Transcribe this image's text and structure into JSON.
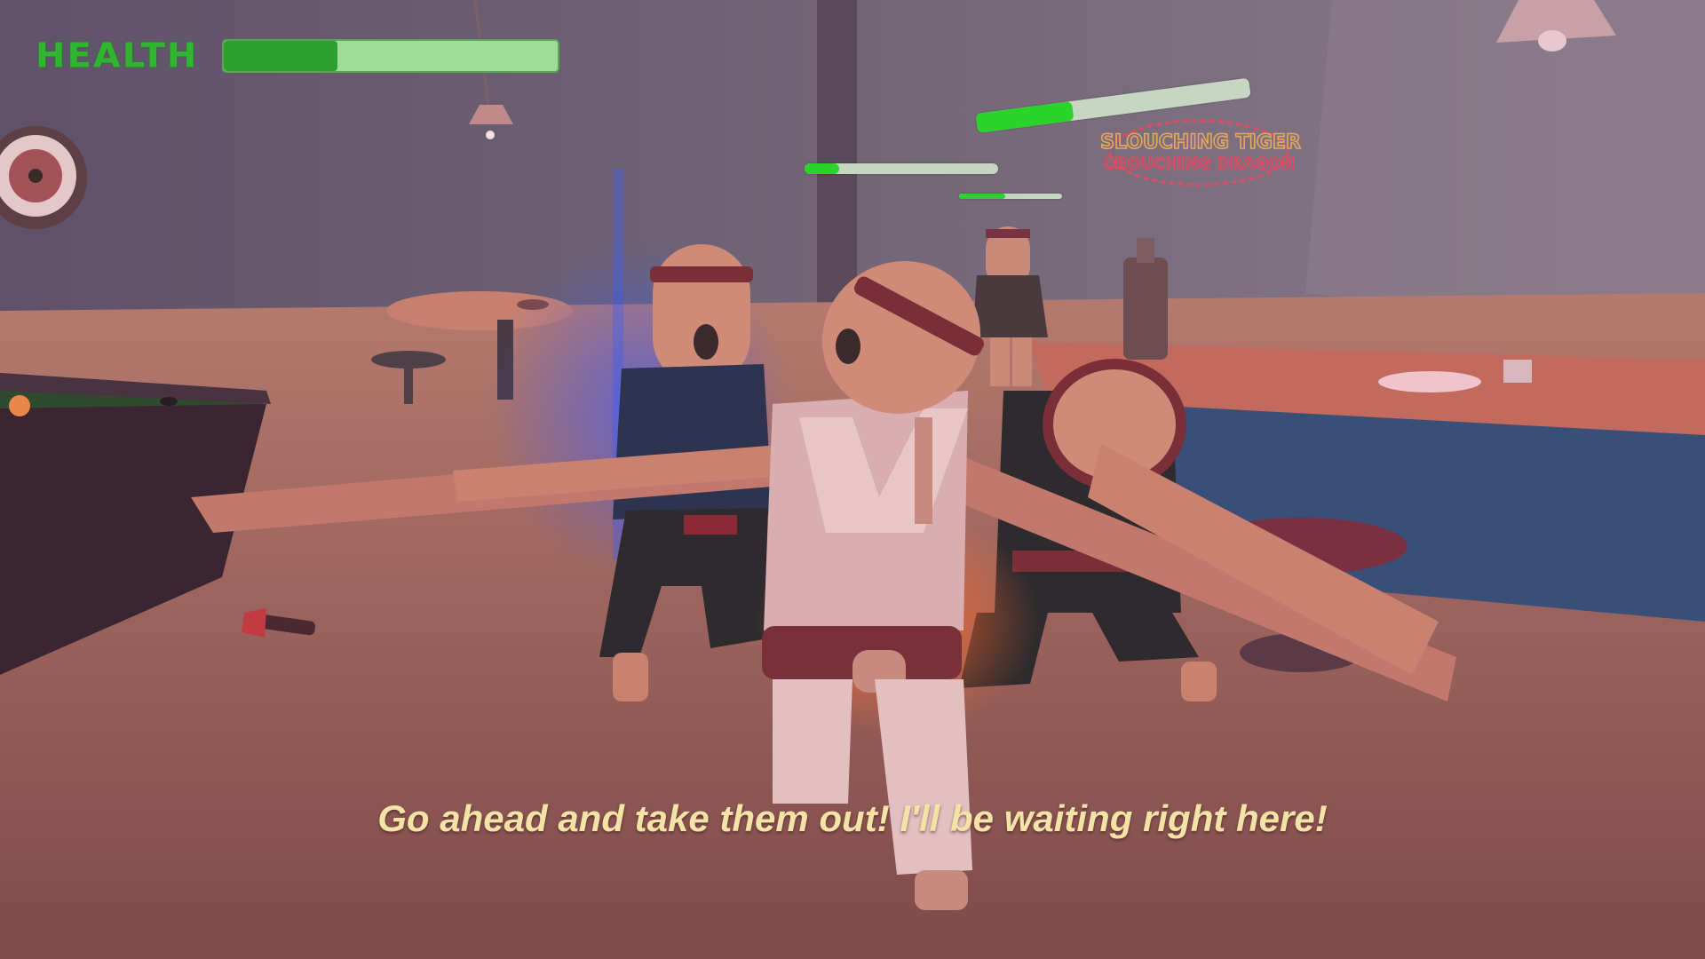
{
  "hud": {
    "health_label": "HEALTH",
    "player_health_fraction": 0.34,
    "enemy_health_fractions": [
      0.35,
      0.18,
      0.45
    ]
  },
  "dialogue": {
    "subtitle": "Go ahead and take them out! I'll be waiting right here!"
  },
  "scene": {
    "neon_sign": [
      "SLOUCHING TIGER",
      "CROUCHING DRAGON"
    ]
  },
  "colors": {
    "health_green": "#2da02d",
    "health_track": "#9fdc9a",
    "subtitle_yellow": "#f3e3a6",
    "floor": "#b5766a",
    "wall": "#6e5d6a"
  }
}
